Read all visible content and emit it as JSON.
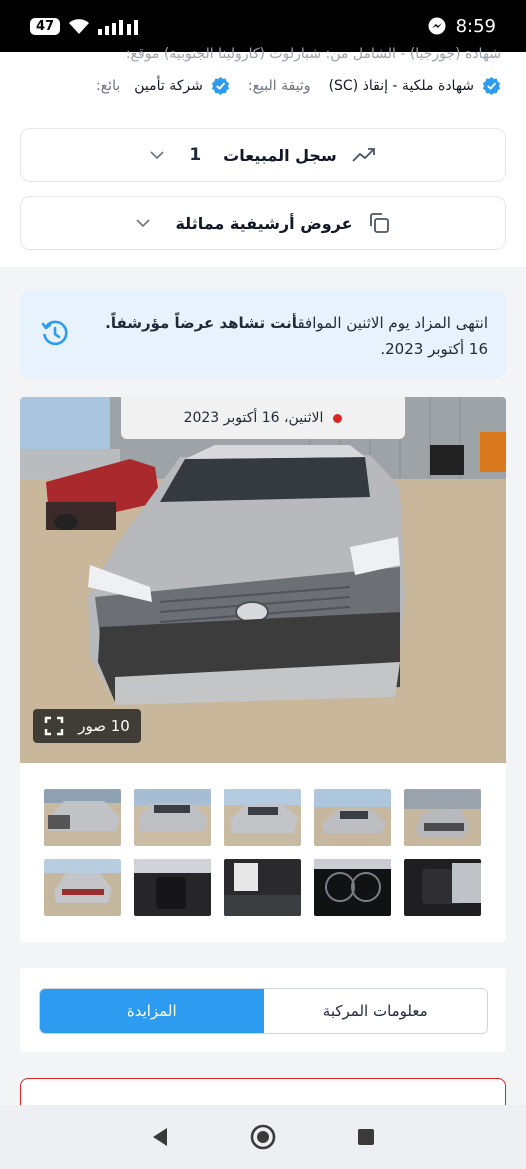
{
  "status_bar": {
    "battery": "47",
    "time": "8:59"
  },
  "info": {
    "cut_off_line": "شهادة (جورجيا) - الشامل من: شبارلوت (كارولينا الجنوبية) موقع:",
    "title_doc_value": "شهادة ملكية - إنقاذ (SC)",
    "sale_doc_label": "وثيقة البيع:",
    "seller_value": "شركة تأمين",
    "seller_label": "بائع:"
  },
  "sales_history": {
    "count": "1",
    "label": "سجل المبيعات"
  },
  "similar_offers": {
    "label": "عروض أرشيفية مماثلة"
  },
  "notice": {
    "text_a": "انتهى المزاد يوم الاثنين الموافق",
    "text_b": "أنت تشاهد عرضاً مؤرشفاً.",
    "text_c": "16 أكتوبر 2023."
  },
  "gallery": {
    "date": "الاثنين، 16 أكتوبر 2023",
    "photo_count": "10 صور",
    "thumb_count": 10
  },
  "tabs": {
    "auction": "المزايدة",
    "vehicle_info": "معلومات المركبة"
  },
  "colors": {
    "accent": "#2d9cf0",
    "notice_bg": "#e8f2fc",
    "verified": "#2d9cf0",
    "alert": "#dc2626"
  }
}
